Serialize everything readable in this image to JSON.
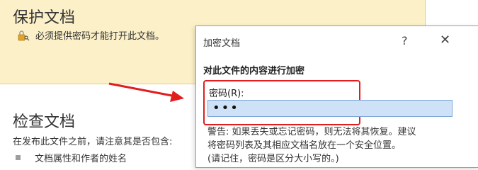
{
  "protect": {
    "title": "保护文档",
    "description": "必须提供密码才能打开此文档。"
  },
  "inspect": {
    "title": "检查文档",
    "description": "在发布此文件之前，请注意其是否包含:",
    "items": [
      "文档属性和作者的姓名"
    ]
  },
  "dialog": {
    "title": "加密文档",
    "help_label": "?",
    "close_label": "✕",
    "heading": "对此文件的内容进行加密",
    "password_label": "密码(R):",
    "password_value": "•••",
    "warning_lines": [
      "警告: 如果丢失或忘记密码，则无法将其恢复。建议",
      "将密码列表及其相应文档名放在一个安全位置。",
      "(请记住，密码是区分大小写的。)"
    ]
  },
  "colors": {
    "protect_bg": "#fcf0c8",
    "highlight": "#e11d1d",
    "input_bg": "#cfe1f7"
  }
}
